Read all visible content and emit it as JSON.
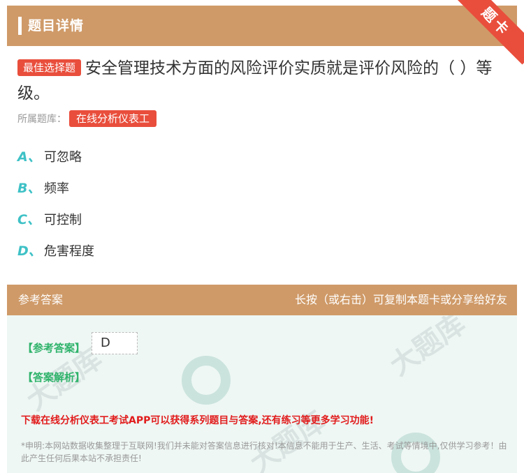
{
  "header": {
    "title": "题目详情",
    "ribbon": "题卡"
  },
  "question": {
    "type_label": "最佳选择题",
    "text": "安全管理技术方面的风险评价实质就是评价风险的（  ）等级。",
    "bank_label": "所属题库：",
    "bank_name": "在线分析仪表工"
  },
  "options": [
    {
      "letter": "A、",
      "text": "可忽略"
    },
    {
      "letter": "B、",
      "text": "频率"
    },
    {
      "letter": "C、",
      "text": "可控制"
    },
    {
      "letter": "D、",
      "text": "危害程度"
    }
  ],
  "answer": {
    "section_title": "参考答案",
    "hint": "长按（或右击）可复制本题卡或分享给好友",
    "ref_label": "【参考答案】",
    "ref_value": "D",
    "analysis_label": "【答案解析】",
    "promo": "下载在线分析仪表工考试APP可以获得系列题目与答案,还有练习等更多学习功能!",
    "disclaimer": "*申明:本网站数据收集整理于互联网!我们并未能对答案信息进行核对!本信息不能用于生产、生活、考试等情境中,仅供学习参考！由此产生任何后果本站不承担责任!"
  },
  "colors": {
    "header_bg": "#cf9a68",
    "accent_red": "#e94e3c",
    "option_letter": "#3ec1c6",
    "answer_label": "#2fb36b",
    "promo": "#e11c1c"
  }
}
